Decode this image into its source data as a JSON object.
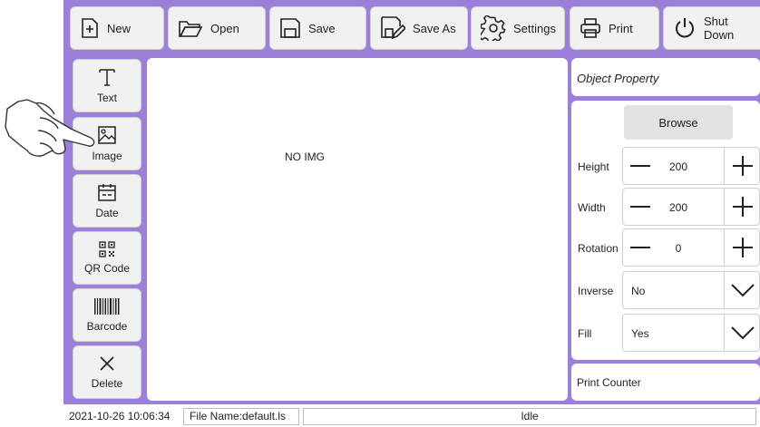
{
  "toolbar": {
    "new": "New",
    "open": "Open",
    "save": "Save",
    "save_as": "Save As",
    "settings": "Settings",
    "print": "Print",
    "shut_down": "Shut Down"
  },
  "sidebar": {
    "text": "Text",
    "image": "Image",
    "date": "Date",
    "qr_code": "QR Code",
    "barcode": "Barcode",
    "delete": "Delete"
  },
  "canvas": {
    "placeholder": "NO IMG"
  },
  "panel": {
    "object_property": "Object Property",
    "browse": "Browse",
    "height_label": "Height",
    "height_value": "200",
    "width_label": "Width",
    "width_value": "200",
    "rotation_label": "Rotation",
    "rotation_value": "0",
    "inverse_label": "Inverse",
    "inverse_value": "No",
    "fill_label": "Fill",
    "fill_value": "Yes",
    "print_counter": "Print Counter"
  },
  "status": {
    "datetime": "2021-10-26 10:06:34",
    "file_name": "File Name:default.ls",
    "state": "Idle"
  },
  "colors": {
    "frame": "#9b7fd9",
    "button": "#f1f1f1"
  }
}
